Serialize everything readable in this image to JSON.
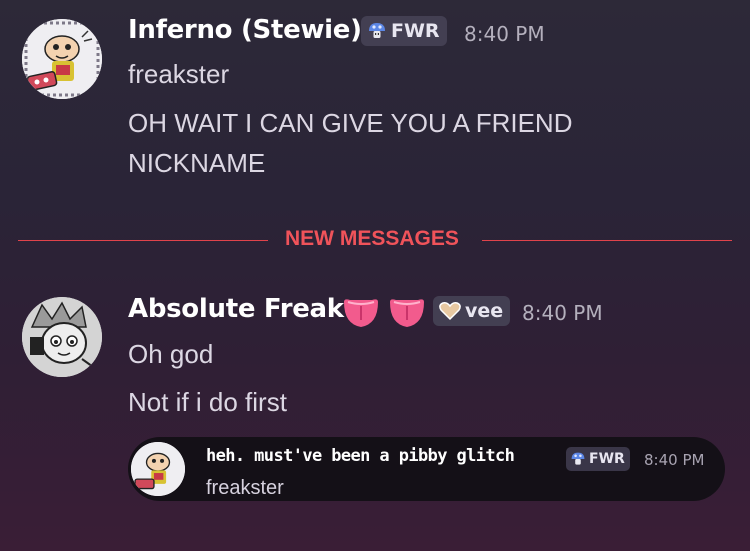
{
  "messages": [
    {
      "author": "Inferno (Stewie)",
      "tag": "FWR",
      "time": "8:40 PM",
      "lines": [
        "freakster",
        "OH WAIT I CAN GIVE YOU A FRIEND",
        "NICKNAME"
      ]
    },
    {
      "author": "Absolute Freak",
      "tag": "vee",
      "time": "8:40 PM",
      "lines": [
        "Oh god",
        "Not if i do first"
      ]
    }
  ],
  "divider_label": "NEW MESSAGES",
  "reply_preview": {
    "author": "heh. must've been a pibby glitch",
    "tag": "FWR",
    "time": "8:40 PM",
    "text": "freakster"
  },
  "colors": {
    "divider": "#e0434b",
    "tag_icon_blue": "#5b86e5"
  }
}
